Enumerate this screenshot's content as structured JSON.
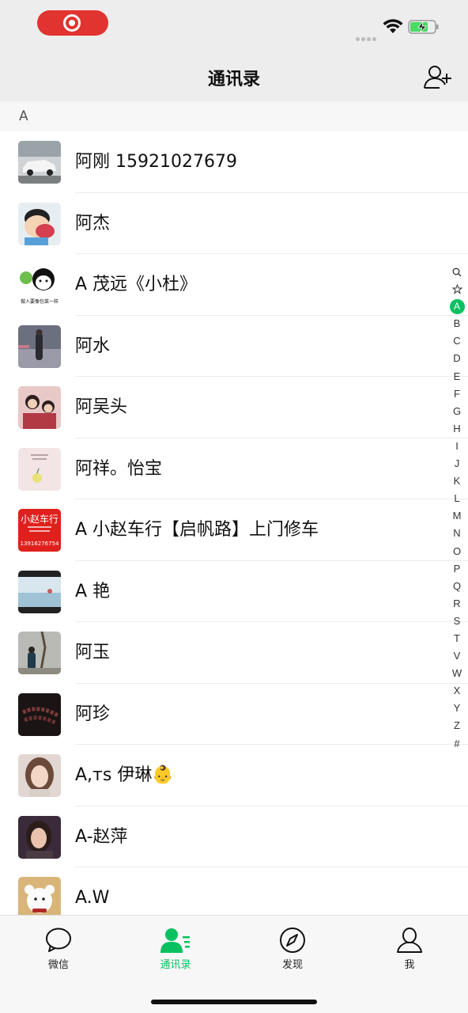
{
  "nav": {
    "title": "通讯录"
  },
  "section": {
    "letter": "A"
  },
  "contacts": [
    {
      "name": "阿刚 15921027679",
      "avatar": "car-photo-avatar"
    },
    {
      "name": "阿杰",
      "avatar": "cartoon-avatar"
    },
    {
      "name": "A 茂远《小杜》",
      "avatar": "meme-face-avatar",
      "avatar_caption": "做人要像包菜一样"
    },
    {
      "name": "阿水",
      "avatar": "person-photo-avatar"
    },
    {
      "name": "阿吴头",
      "avatar": "family-photo-avatar"
    },
    {
      "name": "阿祥。怡宝",
      "avatar": "pastel-drawing-avatar"
    },
    {
      "name": "A 小赵车行【启帆路】上门修车",
      "avatar": "car-shop-sign-avatar",
      "avatar_text": "小赵车行",
      "avatar_phone": "13916276754"
    },
    {
      "name": "A 艳",
      "avatar": "beach-photo-avatar"
    },
    {
      "name": "阿玉",
      "avatar": "outdoor-photo-avatar"
    },
    {
      "name": "阿珍",
      "avatar": "beads-photo-avatar"
    },
    {
      "name": "A,ᴛs 伊琳👶",
      "avatar": "selfie-avatar"
    },
    {
      "name": "A-赵萍",
      "avatar": "portrait-avatar"
    },
    {
      "name": "A.W",
      "avatar": "teddy-bear-avatar"
    }
  ],
  "index_bar": [
    "search-icon",
    "star-icon",
    "A",
    "B",
    "C",
    "D",
    "E",
    "F",
    "G",
    "H",
    "I",
    "J",
    "K",
    "L",
    "M",
    "N",
    "O",
    "P",
    "Q",
    "R",
    "S",
    "T",
    "V",
    "W",
    "X",
    "Y",
    "Z",
    "#"
  ],
  "index_active": "A",
  "tabs": [
    {
      "label": "微信",
      "icon": "chat-bubble-icon",
      "active": false
    },
    {
      "label": "通讯录",
      "icon": "contacts-icon",
      "active": true
    },
    {
      "label": "发现",
      "icon": "compass-icon",
      "active": false
    },
    {
      "label": "我",
      "icon": "person-icon",
      "active": false
    }
  ],
  "colors": {
    "accent": "#07c160",
    "record": "#e1332f",
    "nav_bg": "#ededed"
  }
}
